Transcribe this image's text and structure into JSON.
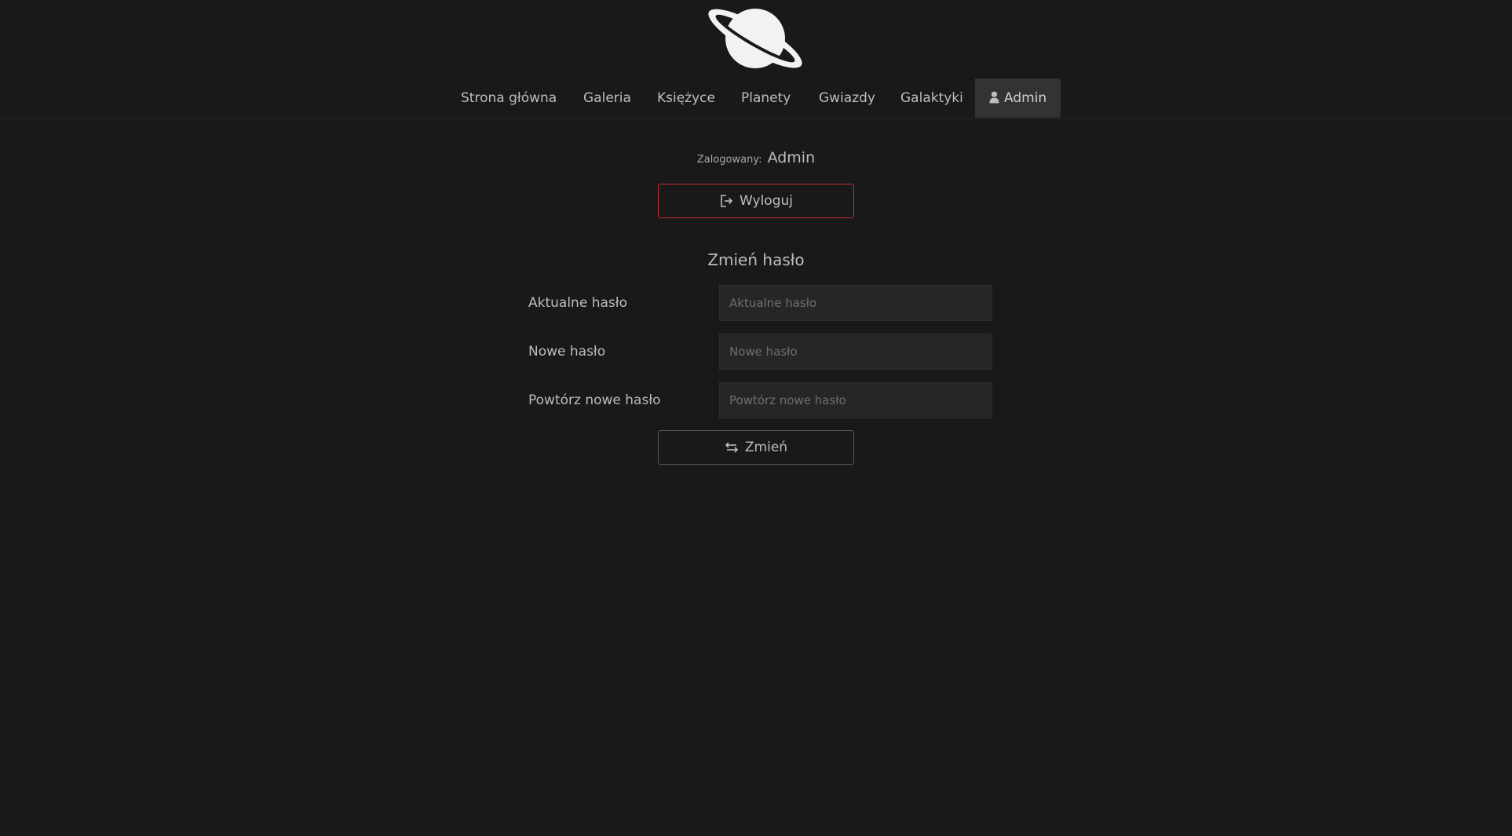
{
  "header": {
    "logo_icon": "saturn-planet-icon",
    "nav": [
      {
        "label": "Strona główna"
      },
      {
        "label": "Galeria"
      },
      {
        "label": "Księżyce"
      },
      {
        "label": "Planety"
      },
      {
        "label": "Gwiazdy"
      },
      {
        "label": "Galaktyki"
      },
      {
        "label": "Admin",
        "icon": "user-icon",
        "active": true
      }
    ]
  },
  "session": {
    "logged_label": "Zalogowany:",
    "user_name": "Admin"
  },
  "logout_button": {
    "label": "Wyloguj",
    "icon": "sign-out-icon",
    "border_color": "#c4302b"
  },
  "change_password": {
    "title": "Zmień hasło",
    "fields": [
      {
        "label": "Aktualne hasło",
        "placeholder": "Aktualne hasło",
        "value": ""
      },
      {
        "label": "Nowe hasło",
        "placeholder": "Nowe hasło",
        "value": ""
      },
      {
        "label": "Powtórz nowe hasło",
        "placeholder": "Powtórz nowe hasło",
        "value": ""
      }
    ],
    "submit_label": "Zmień",
    "submit_icon": "exchange-arrows-icon"
  },
  "colors": {
    "background": "#191919",
    "text": "#bdbdbd",
    "input_background": "#262626",
    "active_nav_background": "#333333"
  }
}
